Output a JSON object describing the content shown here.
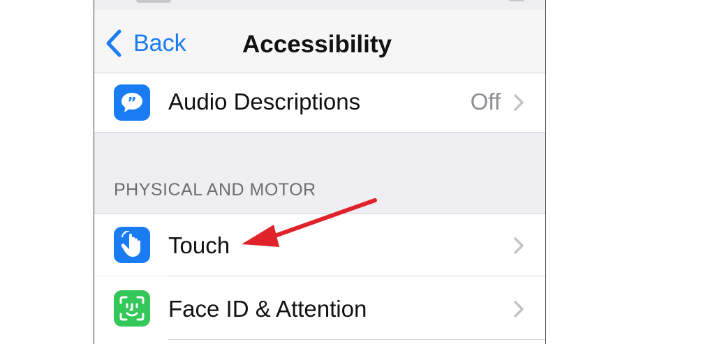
{
  "nav": {
    "back_label": "Back",
    "title": "Accessibility"
  },
  "rows": {
    "audio_descriptions": {
      "label": "Audio Descriptions",
      "value": "Off",
      "icon": "speech-bubble-icon",
      "icon_color": "#1a7cf2"
    },
    "touch": {
      "label": "Touch",
      "icon": "hand-pointer-icon",
      "icon_color": "#1a7cf2"
    },
    "face_id": {
      "label": "Face ID & Attention",
      "icon": "face-id-icon",
      "icon_color": "#34c759"
    }
  },
  "sections": {
    "physical_motor": "PHYSICAL AND MOTOR"
  },
  "colors": {
    "accent": "#1a7cf2",
    "annotation_arrow": "#e0222a",
    "background": "#efeef3"
  }
}
